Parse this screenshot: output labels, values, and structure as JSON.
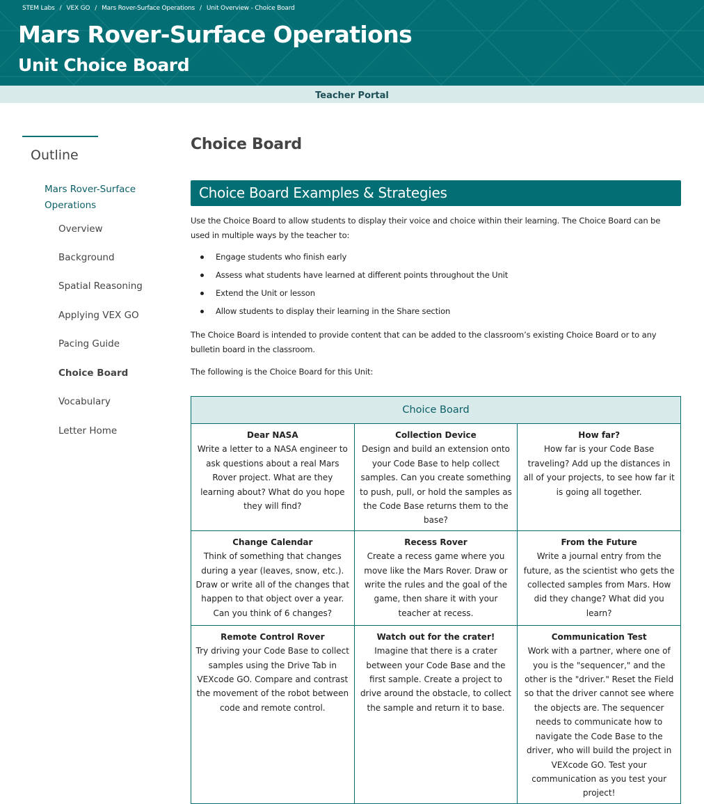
{
  "breadcrumb": [
    {
      "label": "STEM Labs"
    },
    {
      "label": "VEX GO"
    },
    {
      "label": "Mars Rover-Surface Operations"
    },
    {
      "label": "Unit Overview - Choice Board"
    }
  ],
  "breadcrumb_separator": "/",
  "header": {
    "title": "Mars Rover-Surface Operations",
    "subtitle": "Unit Choice Board",
    "portal_link": "Teacher Portal"
  },
  "colors": {
    "brand_teal": "#036f74",
    "light_teal": "#d9eaea",
    "link_teal": "#0b5f66"
  },
  "sidebar": {
    "title": "Outline",
    "unit_link": "Mars Rover-Surface Operations",
    "items": [
      {
        "label": "Overview",
        "active": false
      },
      {
        "label": "Background",
        "active": false
      },
      {
        "label": "Spatial Reasoning",
        "active": false
      },
      {
        "label": "Applying VEX GO",
        "active": false
      },
      {
        "label": "Pacing Guide",
        "active": false
      },
      {
        "label": "Choice Board",
        "active": true
      },
      {
        "label": "Vocabulary",
        "active": false
      },
      {
        "label": "Letter Home",
        "active": false
      }
    ]
  },
  "main": {
    "page_title": "Choice Board",
    "section_title": "Choice Board Examples & Strategies",
    "intro": "Use the Choice Board to allow students to display their voice and choice within their learning. The Choice Board can be used in multiple ways by the teacher to:",
    "bullets": [
      "Engage students who finish early",
      "Assess what students have learned at different points throughout the Unit",
      "Extend the Unit or lesson",
      "Allow students to display their learning in the Share section"
    ],
    "para2": "The Choice Board is intended to provide content that can be added to the classroom’s existing Choice Board or to any bulletin board in the classroom.",
    "para3": "The following is the Choice Board for this Unit:",
    "board": {
      "header": "Choice Board",
      "rows": [
        [
          {
            "title": "Dear NASA",
            "text": "Write a letter to a NASA engineer to ask questions about a real Mars Rover project. What are they learning about? What do you hope they will find?"
          },
          {
            "title": "Collection Device",
            "text": "Design and build an extension onto your Code Base to help collect samples. Can you create something to push, pull, or hold the samples as the Code Base returns them to the base?"
          },
          {
            "title": "How far?",
            "text": "How far is your Code Base traveling? Add up the distances in all of your projects, to see how far it is going all together."
          }
        ],
        [
          {
            "title": "Change Calendar",
            "text": "Think of something that changes during a year (leaves, snow, etc.). Draw or write all of the changes that happen to that object over a year. Can you think of 6 changes?"
          },
          {
            "title": "Recess Rover",
            "text": "Create a recess game where you move like the Mars Rover. Draw or write the rules and the goal of the game, then share it with your teacher at recess."
          },
          {
            "title": "From the Future",
            "text": "Write a journal entry from the future, as the scientist who gets the collected samples from Mars. How did they change? What did you learn?"
          }
        ],
        [
          {
            "title": "Remote Control Rover",
            "text": "Try driving your Code Base to collect samples using the Drive Tab in VEXcode GO. Compare and contrast the movement of the robot between code and remote control."
          },
          {
            "title": "Watch out for the crater!",
            "text": "Imagine that there is a crater between your Code Base and the first sample. Create a project to drive around the obstacle, to collect the sample and return it to base."
          },
          {
            "title": "Communication Test",
            "text": "Work with a partner, where one of you is the \"sequencer,\" and the other is the \"driver.\" Reset the Field so that the driver cannot see where the objects are. The sequencer needs to communicate how to navigate the Code Base to the driver, who will build the project in VEXcode GO. Test your communication as you test your project!"
          }
        ]
      ]
    }
  }
}
